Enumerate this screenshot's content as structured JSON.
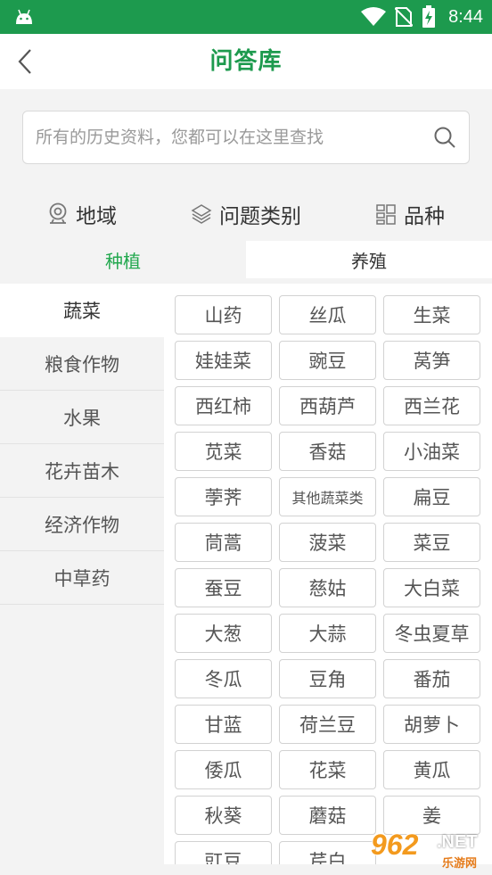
{
  "status_bar": {
    "time": "8:44",
    "icons": [
      "android-icon",
      "wifi-icon",
      "no-sim-icon",
      "battery-charging-icon"
    ]
  },
  "header": {
    "title": "问答库",
    "back_icon": "chevron-left-icon"
  },
  "search": {
    "placeholder": "所有的历史资料，您都可以在这里查找",
    "icon": "search-icon"
  },
  "filters": [
    {
      "label": "地域",
      "icon": "location-icon"
    },
    {
      "label": "问题类别",
      "icon": "layers-icon"
    },
    {
      "label": "品种",
      "icon": "grid-list-icon"
    }
  ],
  "category_tabs": [
    {
      "label": "种植",
      "active": true
    },
    {
      "label": "养殖",
      "active": false
    }
  ],
  "sidebar": {
    "items": [
      {
        "label": "蔬菜",
        "active": true
      },
      {
        "label": "粮食作物",
        "active": false
      },
      {
        "label": "水果",
        "active": false
      },
      {
        "label": "花卉苗木",
        "active": false
      },
      {
        "label": "经济作物",
        "active": false
      },
      {
        "label": "中草药",
        "active": false
      }
    ]
  },
  "varieties": [
    "山药",
    "丝瓜",
    "生菜",
    "娃娃菜",
    "豌豆",
    "莴笋",
    "西红柿",
    "西葫芦",
    "西兰花",
    "苋菜",
    "香菇",
    "小油菜",
    "荸荠",
    "其他蔬菜类",
    "扁豆",
    "茼蒿",
    "菠菜",
    "菜豆",
    "蚕豆",
    "慈姑",
    "大白菜",
    "大葱",
    "大蒜",
    "冬虫夏草",
    "冬瓜",
    "豆角",
    "番茄",
    "甘蓝",
    "荷兰豆",
    "胡萝卜",
    "倭瓜",
    "花菜",
    "黄瓜",
    "秋葵",
    "蘑菇",
    "姜",
    "豇豆",
    "芹白",
    ""
  ],
  "watermark": {
    "number": "962",
    "suffix": ".NET",
    "site": "乐游网"
  },
  "colors": {
    "brand_green": "#1d9a4e",
    "active_tab_green": "#22a84e"
  }
}
